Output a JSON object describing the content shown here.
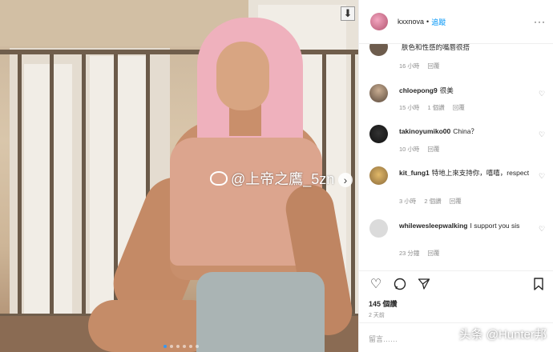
{
  "post": {
    "username": "kxxnova",
    "separator": "•",
    "follow_label": "追蹤",
    "more_glyph": "···",
    "photo": {
      "watermark": "@上帝之鷹_5zn",
      "download_glyph": "⬇",
      "next_glyph": "›",
      "slide_count": 6,
      "active_slide": 1
    }
  },
  "comments": [
    {
      "user": "",
      "text": "肤色和性感的嘴唇很搭",
      "time": "16 小時",
      "reply": "回覆",
      "likes": ""
    },
    {
      "user": "chloepong9",
      "text": "很美",
      "time": "15 小時",
      "likes": "1 個讚",
      "reply": "回覆"
    },
    {
      "user": "takinoyumiko00",
      "text": "China？",
      "time": "10 小時",
      "likes": "",
      "reply": "回覆"
    },
    {
      "user": "kit_fung1",
      "text": "特地上來支持你，嘻嘻，respect",
      "time": "3 小時",
      "likes": "2 個讚",
      "reply": "回覆"
    },
    {
      "user": "whilewesleepwalking",
      "text": "I support you sis",
      "time": "23 分鐘",
      "likes": "",
      "reply": "回覆"
    }
  ],
  "actions": {
    "like_icon": "heart-icon",
    "comment_icon": "comment-icon",
    "share_icon": "share-icon",
    "save_icon": "bookmark-icon",
    "likes_text": "145 個讚",
    "posted": "2 天前",
    "comment_placeholder": "留言……"
  },
  "overlay": {
    "toutiao": "头条 @Hunter邦"
  }
}
